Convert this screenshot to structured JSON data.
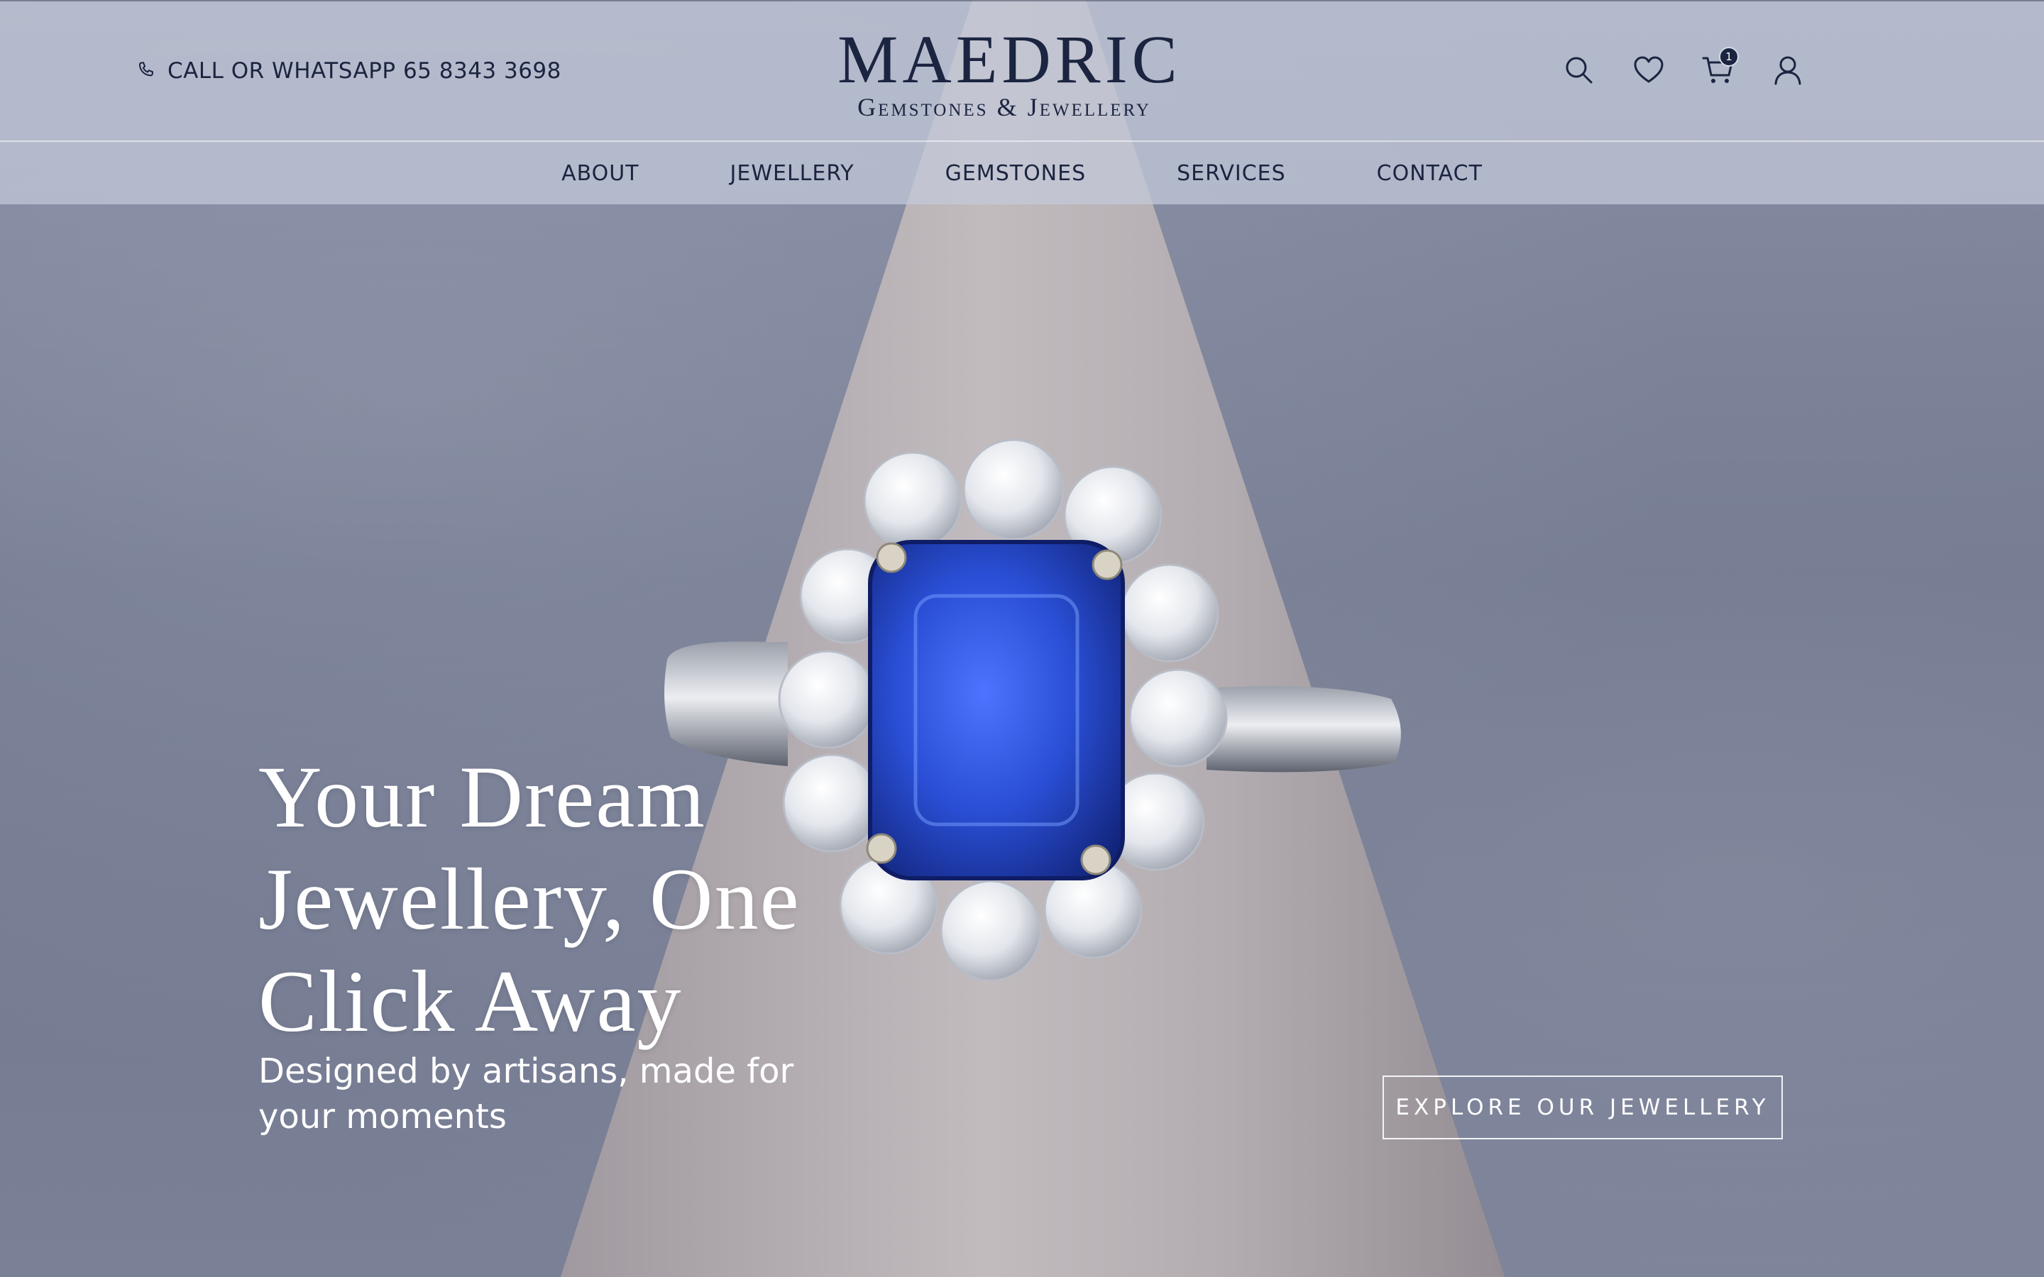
{
  "header": {
    "contact_text": "CALL OR WHATSAPP 65 8343 3698",
    "logo_main": "MAEDRIC",
    "logo_sub": "Gemstones & Jewellery",
    "cart_count": "1"
  },
  "nav": {
    "items": [
      {
        "label": "ABOUT"
      },
      {
        "label": "JEWELLERY"
      },
      {
        "label": "GEMSTONES"
      },
      {
        "label": "SERVICES"
      },
      {
        "label": "CONTACT"
      }
    ]
  },
  "hero": {
    "title": "Your Dream Jewellery, One Click Away",
    "subtitle": "Designed by artisans, made for your moments",
    "cta_label": "EXPLORE OUR JEWELLERY",
    "image_subject": "sapphire-diamond-halo-ring-on-cone"
  },
  "icons": [
    "phone-icon",
    "search-icon",
    "heart-icon",
    "cart-icon",
    "user-icon"
  ],
  "colors": {
    "brand_navy": "#1b2440",
    "header_bg": "#c4cada",
    "sapphire": "#2a4fd6",
    "hero_text": "#ffffff"
  }
}
